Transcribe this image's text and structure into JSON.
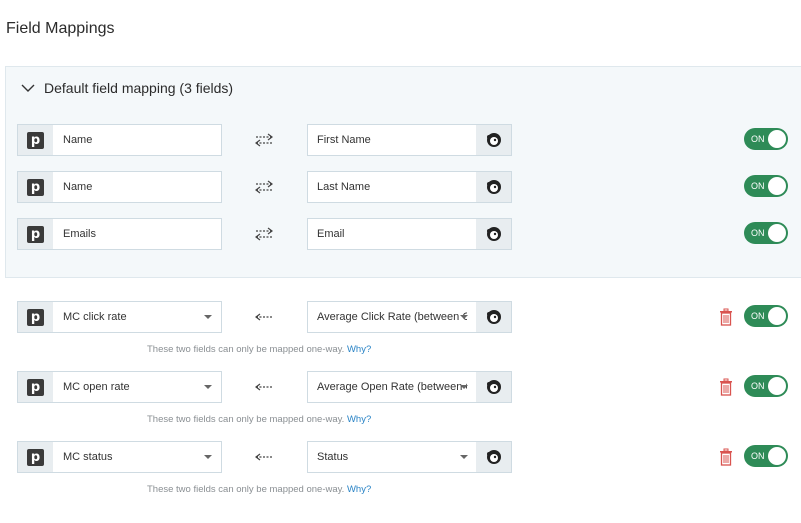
{
  "page": {
    "title": "Field Mappings"
  },
  "default_section": {
    "title": "Default field mapping (3 fields)",
    "rows": [
      {
        "left": "Name",
        "right": "First Name",
        "toggle": "ON"
      },
      {
        "left": "Name",
        "right": "Last Name",
        "toggle": "ON"
      },
      {
        "left": "Emails",
        "right": "Email",
        "toggle": "ON"
      }
    ]
  },
  "custom_rows": [
    {
      "left": "MC click rate",
      "right": "Average Click Rate (between C",
      "toggle": "ON"
    },
    {
      "left": "MC open rate",
      "right": "Average Open Rate (between C",
      "toggle": "ON"
    },
    {
      "left": "MC status",
      "right": "Status",
      "toggle": "ON"
    }
  ],
  "hint": {
    "text": "These two fields can only be mapped one-way.",
    "link": "Why?"
  },
  "colors": {
    "toggle_on": "#2e8b57",
    "link": "#2a84c6",
    "trash": "#d9534f"
  }
}
